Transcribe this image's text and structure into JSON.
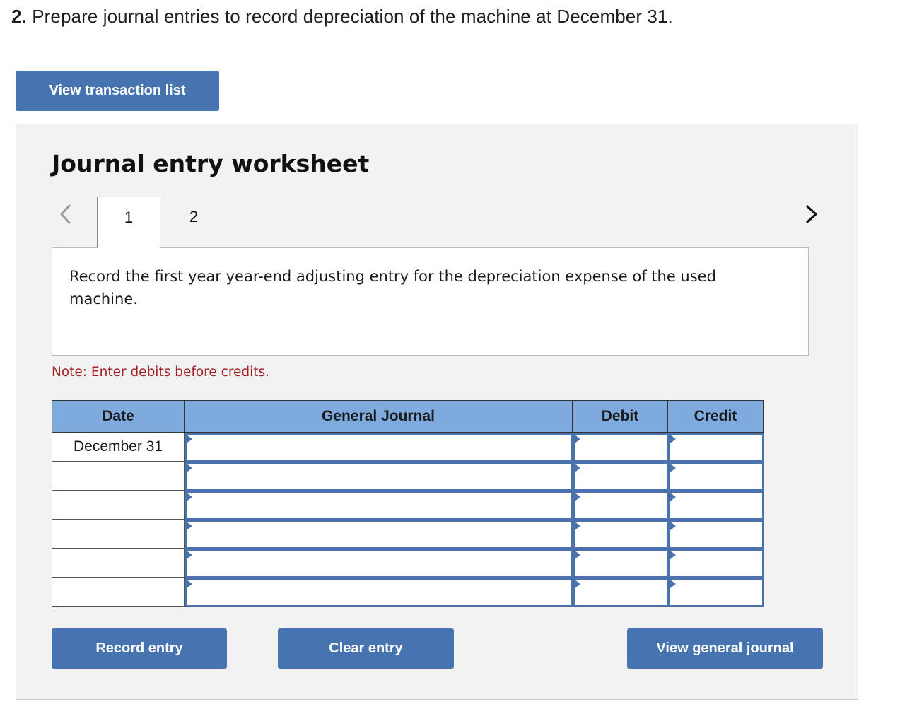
{
  "question": {
    "number": "2.",
    "text": "Prepare journal entries to record depreciation of the machine at December 31."
  },
  "buttons": {
    "view_transactions": "View transaction list",
    "record_entry": "Record entry",
    "clear_entry": "Clear entry",
    "view_general_journal": "View general journal"
  },
  "worksheet": {
    "title": "Journal entry worksheet",
    "tabs": [
      {
        "label": "1",
        "active": true
      },
      {
        "label": "2",
        "active": false
      }
    ],
    "prev_icon": "chevron-left-icon",
    "next_icon": "chevron-right-icon",
    "prompt": "Record the first year year-end adjusting entry for the depreciation expense of the used machine.",
    "note": "Note: Enter debits before credits."
  },
  "table": {
    "headers": [
      "Date",
      "General Journal",
      "Debit",
      "Credit"
    ],
    "rows": [
      {
        "date": "December 31",
        "account": "",
        "debit": "",
        "credit": ""
      },
      {
        "date": "",
        "account": "",
        "debit": "",
        "credit": ""
      },
      {
        "date": "",
        "account": "",
        "debit": "",
        "credit": ""
      },
      {
        "date": "",
        "account": "",
        "debit": "",
        "credit": ""
      },
      {
        "date": "",
        "account": "",
        "debit": "",
        "credit": ""
      },
      {
        "date": "",
        "account": "",
        "debit": "",
        "credit": ""
      }
    ]
  },
  "colors": {
    "button_blue": "#4674b1",
    "header_blue": "#7faadd",
    "note_red": "#a52222"
  }
}
